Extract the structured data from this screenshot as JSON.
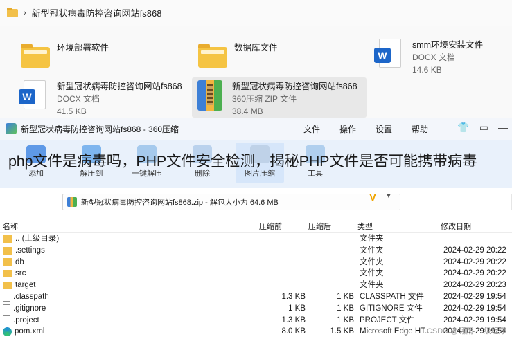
{
  "explorer": {
    "breadcrumb": "新型冠状病毒防控咨询网站fs868",
    "tiles": [
      {
        "name": "环境部署软件",
        "type": "",
        "size": "",
        "icon": "folder-icon"
      },
      {
        "name": "数据库文件",
        "type": "",
        "size": "",
        "icon": "folder-icon"
      },
      {
        "name": "smm环境安装文件",
        "type": "DOCX 文档",
        "size": "14.6 KB",
        "icon": "word-doc-icon"
      },
      {
        "name": "新型冠状病毒防控咨询网站fs868",
        "type": "DOCX 文档",
        "size": "41.5 KB",
        "icon": "word-doc-icon"
      },
      {
        "name": "新型冠状病毒防控咨询网站fs868",
        "type": "360压缩 ZIP 文件",
        "size": "38.4 MB",
        "icon": "zip-archive-icon"
      }
    ]
  },
  "zipwin": {
    "title": "新型冠状病毒防控咨询网站fs868 - 360压缩",
    "menu": [
      "文件",
      "操作",
      "设置",
      "帮助"
    ],
    "tools": [
      "添加",
      "解压到",
      "一键解压",
      "删除",
      "图片压缩",
      "工具"
    ],
    "address": "新型冠状病毒防控咨询网站fs868.zip - 解包大小为 64.6 MB",
    "columns": {
      "name": "名称",
      "size": "压缩前",
      "comp": "压缩后",
      "type": "类型",
      "date": "修改日期"
    },
    "rows": [
      {
        "name": ".. (上级目录)",
        "size": "",
        "comp": "",
        "type": "文件夹",
        "date": "",
        "icon": "folder"
      },
      {
        "name": ".settings",
        "size": "",
        "comp": "",
        "type": "文件夹",
        "date": "2024-02-29 20:22",
        "icon": "folder"
      },
      {
        "name": "db",
        "size": "",
        "comp": "",
        "type": "文件夹",
        "date": "2024-02-29 20:22",
        "icon": "folder"
      },
      {
        "name": "src",
        "size": "",
        "comp": "",
        "type": "文件夹",
        "date": "2024-02-29 20:22",
        "icon": "folder"
      },
      {
        "name": "target",
        "size": "",
        "comp": "",
        "type": "文件夹",
        "date": "2024-02-29 20:23",
        "icon": "folder"
      },
      {
        "name": ".classpath",
        "size": "1.3 KB",
        "comp": "1 KB",
        "type": "CLASSPATH 文件",
        "date": "2024-02-29 19:54",
        "icon": "file"
      },
      {
        "name": ".gitignore",
        "size": "1 KB",
        "comp": "1 KB",
        "type": "GITIGNORE 文件",
        "date": "2024-02-29 19:54",
        "icon": "file"
      },
      {
        "name": ".project",
        "size": "1.3 KB",
        "comp": "1 KB",
        "type": "PROJECT 文件",
        "date": "2024-02-29 19:54",
        "icon": "file"
      },
      {
        "name": "pom.xml",
        "size": "8.0 KB",
        "comp": "1.5 KB",
        "type": "Microsoft Edge HT...",
        "date": "2024-02-29 19:54",
        "icon": "edge"
      }
    ]
  },
  "overlay_title": "php文件是病毒吗，PHP文件安全检测，揭秘PHP文件是否可能携带病毒",
  "watermark": "CSDN @翎雨·二级程序"
}
